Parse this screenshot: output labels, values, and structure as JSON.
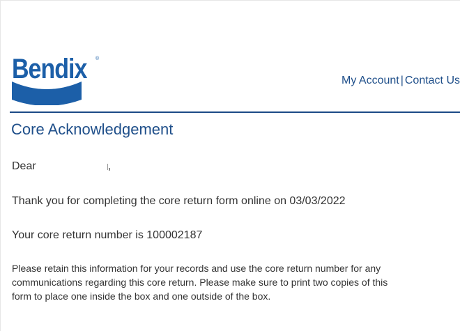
{
  "header": {
    "logo_text": "Bendix",
    "logo_mark": "®",
    "links": [
      "My Account",
      "Contact Us"
    ],
    "link_separator": "|"
  },
  "colors": {
    "brand_blue": "#1c5fa8",
    "heading_blue": "#1f4f8a",
    "rule": "#1b4a86",
    "body_text": "#333333"
  },
  "content": {
    "title": "Core Acknowledgement",
    "greeting": "Dear",
    "greeting_punct": ",",
    "thanks": "Thank you for completing the core return form online on 03/03/2022",
    "core_number": "Your core return number is 100002187",
    "instructions": "Please retain this information for your records and use the core return number for any communications regarding this core return. Please make sure to print two copies of this form to place one inside the box and one outside of the box."
  }
}
